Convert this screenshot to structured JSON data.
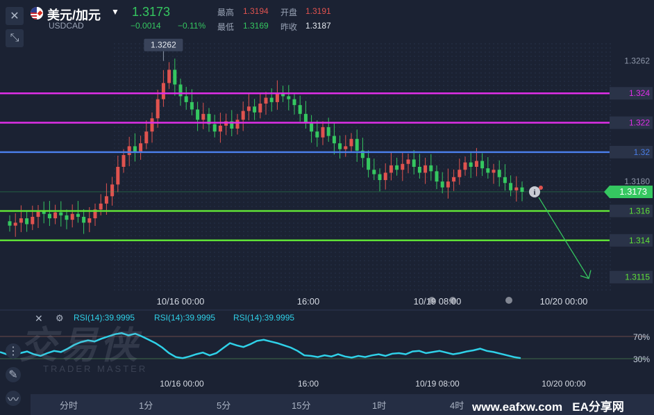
{
  "header": {
    "pair_name": "美元/加元",
    "symbol": "USDCAD",
    "price": "1.3173",
    "change": "−0.0014",
    "change_pct": "−0.11%",
    "high_label": "最高",
    "high_value": "1.3194",
    "open_label": "开盘",
    "open_value": "1.3191",
    "low_label": "最低",
    "low_value": "1.3169",
    "prev_close_label": "昨收",
    "prev_close_value": "1.3187"
  },
  "colors": {
    "up": "#e0534f",
    "down": "#35c760",
    "magenta_line": "#e02fe8",
    "blue_line": "#4a7ee8",
    "green_line": "#5fe037",
    "rsi": "#2fd1e8",
    "background": "#1b2233"
  },
  "chart_data": {
    "type": "candlestick",
    "x_labels": [
      "10/16 00:00",
      "16:00",
      "10/19 08:00",
      "10/20 00:00"
    ],
    "y_tick_labels": [
      "1.3262",
      "1.3180",
      "1.3115"
    ],
    "ylim": [
      1.3112,
      1.3268
    ],
    "high_marker": "1.3262",
    "current_price_label": "1.3173",
    "horizontal_lines": [
      {
        "label": "1.324",
        "value": 1.324,
        "color": "magenta"
      },
      {
        "label": "1.322",
        "value": 1.322,
        "color": "magenta"
      },
      {
        "label": "1.32",
        "value": 1.32,
        "color": "blue"
      },
      {
        "label": "1.316",
        "value": 1.316,
        "color": "green"
      },
      {
        "label": "1.314",
        "value": 1.314,
        "color": "green"
      }
    ],
    "close_series": [
      1.315,
      1.3152,
      1.3155,
      1.3151,
      1.3156,
      1.316,
      1.3158,
      1.3155,
      1.3159,
      1.3157,
      1.3154,
      1.3158,
      1.3156,
      1.3152,
      1.3155,
      1.3161,
      1.3165,
      1.317,
      1.3178,
      1.319,
      1.3198,
      1.3204,
      1.32,
      1.3206,
      1.3214,
      1.3223,
      1.3236,
      1.3247,
      1.3256,
      1.3246,
      1.3238,
      1.3234,
      1.3229,
      1.3222,
      1.3226,
      1.3219,
      1.3214,
      1.3218,
      1.3221,
      1.3216,
      1.3222,
      1.3228,
      1.3231,
      1.3227,
      1.3233,
      1.3237,
      1.3234,
      1.324,
      1.3238,
      1.3236,
      1.3232,
      1.3226,
      1.322,
      1.3214,
      1.321,
      1.3217,
      1.3211,
      1.3206,
      1.3202,
      1.3204,
      1.3209,
      1.3201,
      1.3196,
      1.3188,
      1.3185,
      1.3181,
      1.3186,
      1.3191,
      1.3188,
      1.3192,
      1.3195,
      1.319,
      1.3186,
      1.3191,
      1.3187,
      1.318,
      1.3176,
      1.318,
      1.3183,
      1.3188,
      1.3193,
      1.319,
      1.3194,
      1.3189,
      1.3186,
      1.3188,
      1.3183,
      1.3179,
      1.3174,
      1.3176,
      1.3173
    ],
    "rsi": {
      "label": "RSI(14):39.9995",
      "levels": [
        "70%",
        "30%"
      ],
      "values": [
        42,
        38,
        36,
        40,
        43,
        38,
        35,
        40,
        44,
        42,
        48,
        55,
        60,
        63,
        61,
        66,
        70,
        74,
        76,
        72,
        75,
        70,
        64,
        58,
        50,
        40,
        33,
        31,
        34,
        38,
        41,
        36,
        40,
        49,
        58,
        54,
        51,
        56,
        62,
        64,
        61,
        58,
        54,
        50,
        44,
        36,
        35,
        33,
        36,
        34,
        38,
        34,
        32,
        35,
        33,
        36,
        38,
        35,
        39,
        40,
        38,
        43,
        44,
        40,
        42,
        44,
        41,
        38,
        40,
        43,
        45,
        48,
        44,
        42,
        39,
        36,
        33,
        31
      ],
      "x_labels": [
        "10/16 00:00",
        "16:00",
        "10/19 08:00",
        "10/20 00:00"
      ]
    }
  },
  "timeframes": [
    "分时",
    "1分",
    "5分",
    "15分",
    "1时",
    "4时"
  ],
  "watermark": {
    "logo": "交易侠",
    "sub": "TRADER MASTER",
    "site": "www.eafxw.com",
    "site2": "EA分享网"
  }
}
